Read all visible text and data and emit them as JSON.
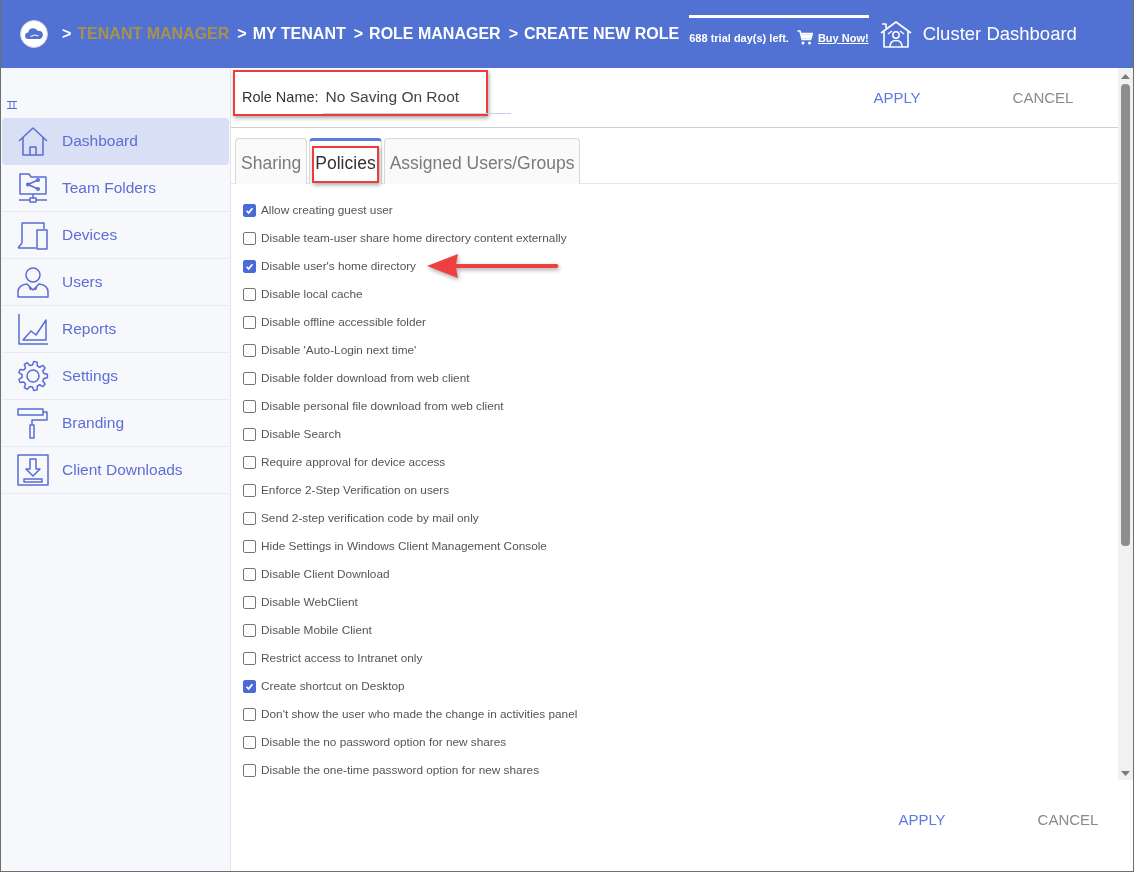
{
  "header": {
    "breadcrumb": [
      {
        "separator": ">",
        "label": "TENANT MANAGER",
        "color": "#a8924a"
      },
      {
        "separator": ">",
        "label": "MY TENANT",
        "color": "#ffffff"
      },
      {
        "separator": ">",
        "label": "ROLE MANAGER",
        "color": "#ffffff"
      },
      {
        "separator": ">",
        "label": "CREATE NEW ROLE",
        "color": "#ffffff"
      }
    ],
    "trial_notice": "688 trial day(s) left.",
    "buy_link": "Buy Now!",
    "dashboard_link": "Cluster Dashboard"
  },
  "sidebar": {
    "items": [
      {
        "label": "Dashboard",
        "selected": true
      },
      {
        "label": "Team Folders",
        "selected": false
      },
      {
        "label": "Devices",
        "selected": false
      },
      {
        "label": "Users",
        "selected": false
      },
      {
        "label": "Reports",
        "selected": false
      },
      {
        "label": "Settings",
        "selected": false
      },
      {
        "label": "Branding",
        "selected": false
      },
      {
        "label": "Client Downloads",
        "selected": false
      }
    ]
  },
  "role_name": {
    "label": "Role Name:",
    "value": "No Saving On Root",
    "highlighted": true
  },
  "top_actions": [
    {
      "label": "APPLY",
      "kind": "apply"
    },
    {
      "label": "CANCEL",
      "kind": "cancel"
    }
  ],
  "tabs": [
    {
      "label": "Sharing",
      "selected": false,
      "highlighted": false
    },
    {
      "label": "Policies",
      "selected": true,
      "highlighted": true
    },
    {
      "label": "Assigned Users/Groups",
      "selected": false,
      "highlighted": false
    }
  ],
  "policies": [
    {
      "label": "Allow creating guest user",
      "checked": true,
      "arrow": false
    },
    {
      "label": "Disable team-user share home directory content externally",
      "checked": false,
      "arrow": false
    },
    {
      "label": "Disable user's home directory",
      "checked": true,
      "arrow": true
    },
    {
      "label": "Disable local cache",
      "checked": false,
      "arrow": false
    },
    {
      "label": "Disable offline accessible folder",
      "checked": false,
      "arrow": false
    },
    {
      "label": "Disable 'Auto-Login next time'",
      "checked": false,
      "arrow": false
    },
    {
      "label": "Disable folder download from web client",
      "checked": false,
      "arrow": false
    },
    {
      "label": "Disable personal file download from web client",
      "checked": false,
      "arrow": false
    },
    {
      "label": "Disable Search",
      "checked": false,
      "arrow": false
    },
    {
      "label": "Require approval for device access",
      "checked": false,
      "arrow": false
    },
    {
      "label": "Enforce 2-Step Verification on users",
      "checked": false,
      "arrow": false
    },
    {
      "label": "Send 2-step verification code by mail only",
      "checked": false,
      "arrow": false
    },
    {
      "label": "Hide Settings in Windows Client Management Console",
      "checked": false,
      "arrow": false
    },
    {
      "label": "Disable Client Download",
      "checked": false,
      "arrow": false
    },
    {
      "label": "Disable WebClient",
      "checked": false,
      "arrow": false
    },
    {
      "label": "Disable Mobile Client",
      "checked": false,
      "arrow": false
    },
    {
      "label": "Restrict access to Intranet only",
      "checked": false,
      "arrow": false
    },
    {
      "label": "Create shortcut on Desktop",
      "checked": true,
      "arrow": false
    },
    {
      "label": "Don't show the user who made the change in activities panel",
      "checked": false,
      "arrow": false
    },
    {
      "label": "Disable the no password option for new shares",
      "checked": false,
      "arrow": false
    },
    {
      "label": "Disable the one-time password option for new shares",
      "checked": false,
      "arrow": false
    }
  ],
  "bottom_actions": [
    {
      "label": "APPLY",
      "kind": "apply"
    },
    {
      "label": "CANCEL",
      "kind": "cancel"
    }
  ]
}
